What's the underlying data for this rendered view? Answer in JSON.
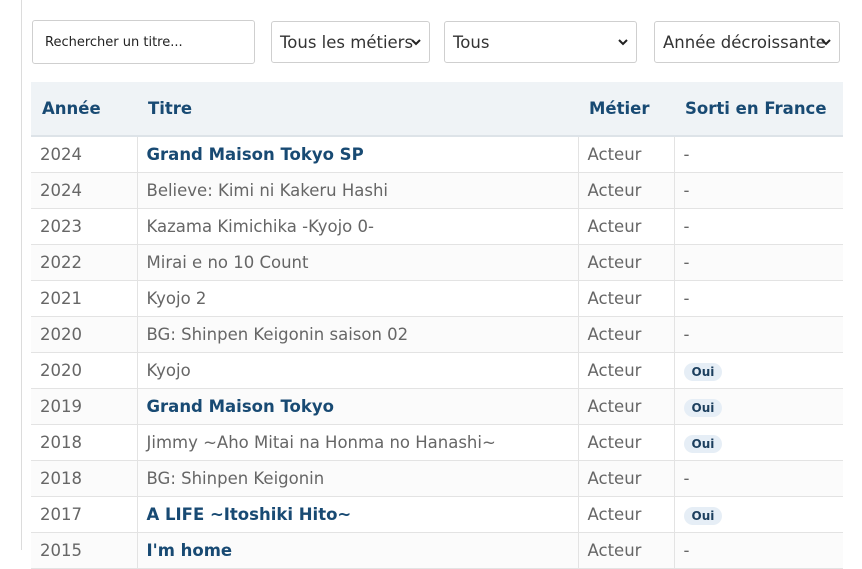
{
  "filters": {
    "search_placeholder": "Rechercher un titre...",
    "metier_value": "Tous les métiers",
    "type_value": "Tous",
    "order_value": "Année décroissante"
  },
  "table": {
    "headers": {
      "year": "Année",
      "title": "Titre",
      "job": "Métier",
      "released": "Sorti en France"
    },
    "rows": [
      {
        "year": "2024",
        "title": "Grand Maison Tokyo SP",
        "season": "",
        "linked": true,
        "job": "Acteur",
        "released": "-"
      },
      {
        "year": "2024",
        "title": "Believe: Kimi ni Kakeru Hashi",
        "season": "",
        "linked": false,
        "job": "Acteur",
        "released": "-"
      },
      {
        "year": "2023",
        "title": "Kazama Kimichika -Kyojo 0-",
        "season": "",
        "linked": false,
        "job": "Acteur",
        "released": "-"
      },
      {
        "year": "2022",
        "title": "Mirai e no 10 Count",
        "season": "",
        "linked": false,
        "job": "Acteur",
        "released": "-"
      },
      {
        "year": "2021",
        "title": "Kyojo 2",
        "season": "",
        "linked": false,
        "job": "Acteur",
        "released": "-"
      },
      {
        "year": "2020",
        "title": "BG: Shinpen Keigonin",
        "season": "saison 02",
        "linked": false,
        "job": "Acteur",
        "released": "-"
      },
      {
        "year": "2020",
        "title": "Kyojo",
        "season": "",
        "linked": false,
        "job": "Acteur",
        "released": "Oui"
      },
      {
        "year": "2019",
        "title": "Grand Maison Tokyo",
        "season": "",
        "linked": true,
        "job": "Acteur",
        "released": "Oui"
      },
      {
        "year": "2018",
        "title": "Jimmy ~Aho Mitai na Honma no Hanashi~",
        "season": "",
        "linked": false,
        "job": "Acteur",
        "released": "Oui"
      },
      {
        "year": "2018",
        "title": "BG: Shinpen Keigonin",
        "season": "",
        "linked": false,
        "job": "Acteur",
        "released": "-"
      },
      {
        "year": "2017",
        "title": "A LIFE ~Itoshiki Hito~",
        "season": "",
        "linked": true,
        "job": "Acteur",
        "released": "Oui"
      },
      {
        "year": "2015",
        "title": "I'm home",
        "season": "",
        "linked": true,
        "job": "Acteur",
        "released": "-"
      }
    ]
  }
}
